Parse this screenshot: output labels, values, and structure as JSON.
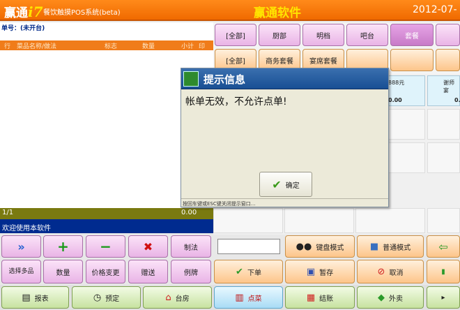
{
  "header": {
    "logo_text": "赢通",
    "logo_i7": "i7",
    "subtitle": "餐饮触摸POS系统(beta)",
    "app_title": "赢通软件",
    "datetime": "2012-07-"
  },
  "order": {
    "order_no": "单号：(未开台)",
    "columns": [
      "行",
      "菜品名称/做法",
      "标志",
      "数量",
      "小计",
      "印"
    ],
    "page": "1/1",
    "total": "0.00",
    "welcome": "欢迎使用本软件"
  },
  "categories": {
    "row1": [
      "[全部]",
      "厨部",
      "明档",
      "吧台",
      "套餐"
    ],
    "row2": [
      "[全部]",
      "商务套餐",
      "宴席套餐"
    ]
  },
  "dishes": [
    {
      "name": "",
      "price": "888元",
      "qty": "0.00"
    },
    {
      "name": "谢师宴",
      "price": "",
      "qty": "0."
    }
  ],
  "dialog": {
    "title": "提示信息",
    "message": "帐单无效，不允许点单!",
    "ok_label": "确定",
    "hint": "按回车键或ESC键关闭提示窗口..."
  },
  "actions": {
    "row1": [
      "制法"
    ],
    "row2": [
      "选择多品",
      "数量",
      "价格变更",
      "赠送",
      "例牌"
    ],
    "keyboard_mode": "键盘模式",
    "normal_mode": "普通模式",
    "order": "下单",
    "hold": "暂存",
    "cancel": "取消"
  },
  "bottom": {
    "report": "报表",
    "reserve": "预定",
    "table": "台房",
    "dish": "点菜",
    "checkout": "结账",
    "takeout": "外卖"
  },
  "colors": {
    "header": "#f07a10",
    "accent_yellow": "#ffe400",
    "welcome_bar": "#002b8f",
    "dialog_title": "#1f5a9e"
  }
}
